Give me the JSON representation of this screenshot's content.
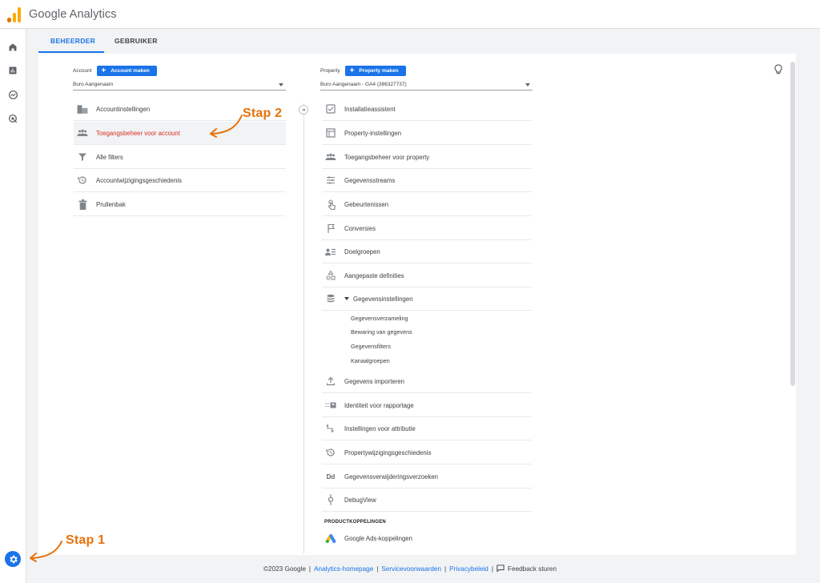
{
  "app": {
    "title": "Google Analytics"
  },
  "tabs": [
    {
      "label": "BEHEERDER",
      "active": true
    },
    {
      "label": "GEBRUIKER",
      "active": false
    }
  ],
  "account": {
    "label": "Account",
    "create_label": "Account maken",
    "selected": "Buro Aangenaam",
    "items": [
      {
        "label": "Accountinstellingen",
        "icon": "building-icon"
      },
      {
        "label": "Toegangsbeheer voor account",
        "icon": "people-icon",
        "highlighted": true
      },
      {
        "label": "Alle filters",
        "icon": "filter-icon"
      },
      {
        "label": "Accountwijzigingsgeschiedenis",
        "icon": "history-icon"
      },
      {
        "label": "Prullenbak",
        "icon": "trash-icon"
      }
    ]
  },
  "property": {
    "label": "Property",
    "create_label": "Property maken",
    "selected": "Buro Aangenaam - GA4 (386327737)",
    "items": [
      {
        "label": "Installatieassistent",
        "icon": "checkbox-icon"
      },
      {
        "label": "Property-instellingen",
        "icon": "window-icon"
      },
      {
        "label": "Toegangsbeheer voor property",
        "icon": "people-icon"
      },
      {
        "label": "Gegevensstreams",
        "icon": "streams-icon"
      },
      {
        "label": "Gebeurtenissen",
        "icon": "touch-icon"
      },
      {
        "label": "Conversies",
        "icon": "flag-icon"
      },
      {
        "label": "Doelgroepen",
        "icon": "audience-icon"
      },
      {
        "label": "Aangepaste definities",
        "icon": "shapes-icon"
      },
      {
        "label": "Gegevensinstellingen",
        "icon": "database-icon",
        "expanded": true
      }
    ],
    "sub_items": [
      "Gegevensverzameling",
      "Bewaring van gegevens",
      "Gegevensfilters",
      "Kanaalgroepen"
    ],
    "items_after": [
      {
        "label": "Gegevens importeren",
        "icon": "upload-icon"
      },
      {
        "label": "Identiteit voor rapportage",
        "icon": "identity-icon"
      },
      {
        "label": "Instellingen voor attributie",
        "icon": "attribution-icon"
      },
      {
        "label": "Propertywijzigingsgeschiedenis",
        "icon": "history-icon"
      },
      {
        "label": "Gegevensverwijderingsverzoeken",
        "icon": "dd-icon"
      },
      {
        "label": "DebugView",
        "icon": "debug-icon"
      }
    ],
    "section_label": "PRODUCTKOPPELINGEN",
    "links": [
      {
        "label": "Google Ads-koppelingen",
        "icon": "google-ads-icon"
      }
    ]
  },
  "annotations": {
    "step1": "Stap 1",
    "step2": "Stap 2"
  },
  "footer": {
    "copyright": "©2023 Google",
    "links": [
      "Analytics-homepage",
      "Servicevoorwaarden",
      "Privacybeleid"
    ],
    "feedback": "Feedback sturen"
  },
  "colors": {
    "accent": "#1a73e8",
    "annotation": "#e8710a",
    "highlight_text": "#d93025"
  }
}
